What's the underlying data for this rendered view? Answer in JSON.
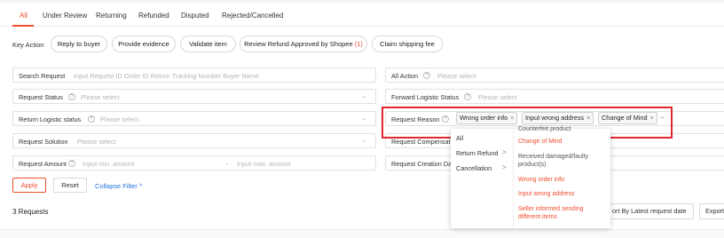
{
  "tabs": [
    {
      "label": "All",
      "active": true
    },
    {
      "label": "Under Review"
    },
    {
      "label": "Returning"
    },
    {
      "label": "Refunded"
    },
    {
      "label": "Disputed"
    },
    {
      "label": "Rejected/Cancelled"
    }
  ],
  "key_action": {
    "label": "Key Action",
    "chips": [
      {
        "label": "Reply to buyer"
      },
      {
        "label": "Provide evidence"
      },
      {
        "label": "Validate item"
      },
      {
        "label": "Review Refund Approved by Shopee",
        "count": "(1)"
      },
      {
        "label": "Claim shipping fee"
      }
    ]
  },
  "filters": {
    "search": {
      "label": "Search Request",
      "placeholder": "Input Request ID Order ID Return Tracking Number Buyer Name"
    },
    "all_action": {
      "label": "All Action",
      "placeholder": "Please select"
    },
    "request_status": {
      "label": "Request Status",
      "placeholder": "Please select"
    },
    "forward_logistic": {
      "label": "Forward Logistic Status",
      "placeholder": "Please select"
    },
    "return_logistic": {
      "label": "Return Logistic status",
      "placeholder": "Please select"
    },
    "request_reason": {
      "label": "Request Reason",
      "tags": [
        "Wrong order info",
        "Input wrong address",
        "Change of Mind"
      ],
      "more": "..",
      "remove_symbol": "×"
    },
    "request_solution": {
      "label": "Request Solution",
      "placeholder": "Please select"
    },
    "request_compensation": {
      "label": "Request Compensatio"
    },
    "request_amount": {
      "label": "Request Amount",
      "min_placeholder": "Input min. amount",
      "separator": "-",
      "max_placeholder": "Input max. amount"
    },
    "request_creation": {
      "label": "Request Creation Da"
    }
  },
  "buttons": {
    "apply": "Apply",
    "reset": "Reset",
    "collapse": "Collapse Filter ^"
  },
  "results": {
    "count_label": "3 Requests",
    "sort_label": "ort By Latest request date",
    "export_label": "Export"
  },
  "dropdown": {
    "left": [
      {
        "label": "All"
      },
      {
        "label": "Return Refund",
        "arrow": ">"
      },
      {
        "label": "Cancellation",
        "arrow": ">"
      }
    ],
    "right": [
      {
        "label": "Counterfeit product",
        "style": "grey"
      },
      {
        "label": "Change of Mind",
        "style": "red"
      },
      {
        "label": "Received damaged/faulty",
        "style": "grey"
      },
      {
        "label": "product(s)",
        "style": "grey"
      },
      {
        "label": "Wrong order info",
        "style": "red"
      },
      {
        "label": "Input wrong address",
        "style": "red"
      },
      {
        "label": "Seller informed sending",
        "style": "red"
      },
      {
        "label": "different items",
        "style": "red"
      }
    ]
  },
  "colors": {
    "accent": "#ee4d2d",
    "link": "#2673dd",
    "highlight_box": "#e3262d"
  },
  "icons": {
    "help": "question-circle-icon",
    "caret": "chevron-down-icon",
    "remove": "close-icon"
  }
}
